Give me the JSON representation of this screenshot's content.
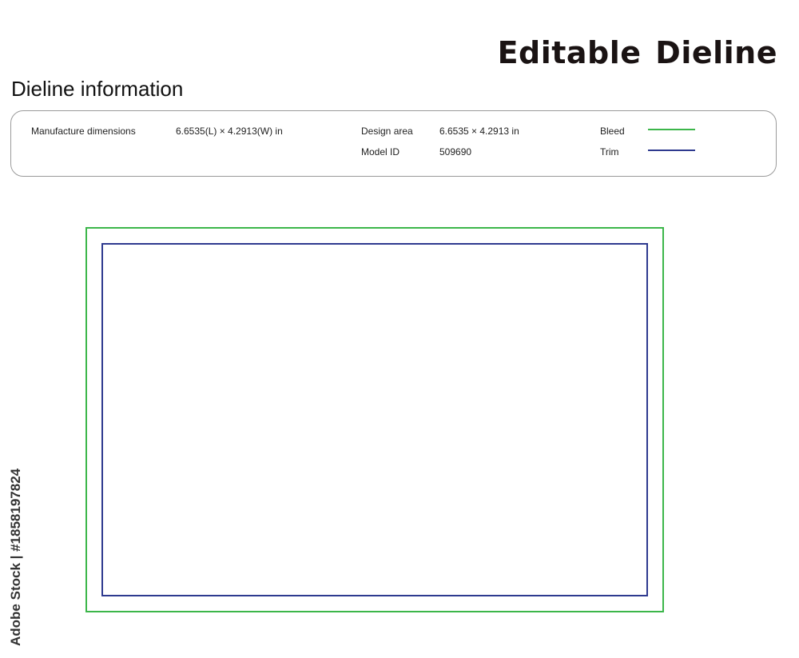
{
  "header": {
    "brand_title": "Editable Dieline"
  },
  "section": {
    "title": "Dieline information"
  },
  "info": {
    "manufacture_label": "Manufacture dimensions",
    "manufacture_value": "6.6535(L) × 4.2913(W) in",
    "design_area_label": "Design area",
    "design_area_value": "6.6535 × 4.2913 in",
    "model_id_label": "Model ID",
    "model_id_value": "509690"
  },
  "legend": {
    "bleed_label": "Bleed",
    "bleed_color": "#3cb64a",
    "trim_label": "Trim",
    "trim_color": "#2e3a8f"
  },
  "watermark": {
    "side_text": "Adobe Stock | #1858197824"
  }
}
